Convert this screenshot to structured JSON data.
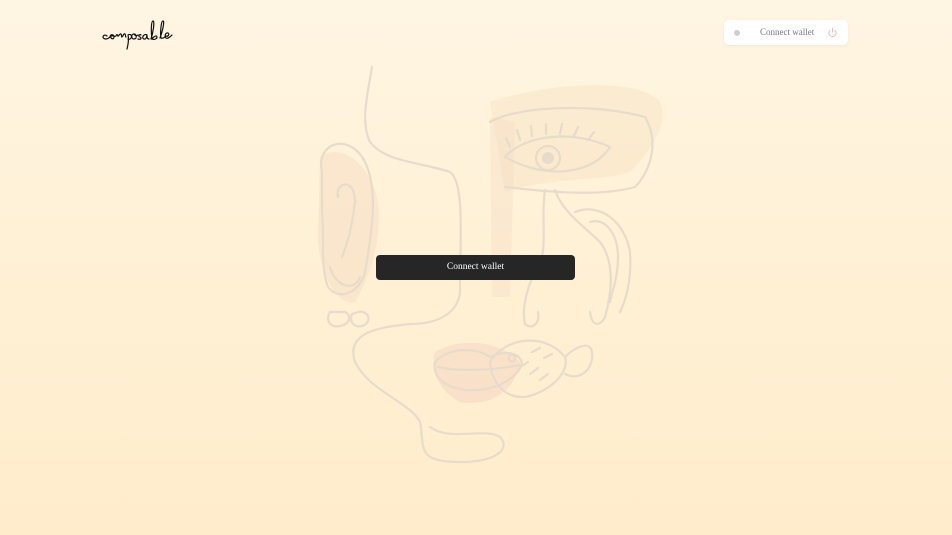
{
  "header": {
    "logo_text": "composable",
    "logo_icon": "composable-script-logo",
    "wallet": {
      "status_icon": "status-dot",
      "status_color": "#cfcfcf",
      "label": "Connect wallet",
      "power_icon": "power-icon",
      "power_color": "#f4b3bd"
    }
  },
  "main": {
    "illustration": "line-art-face-illustration",
    "connect_button_label": "Connect wallet"
  },
  "colors": {
    "background_top": "#fff5e3",
    "background_bottom": "#ffeccb",
    "button_bg": "#262626",
    "button_text": "#ffffff"
  }
}
